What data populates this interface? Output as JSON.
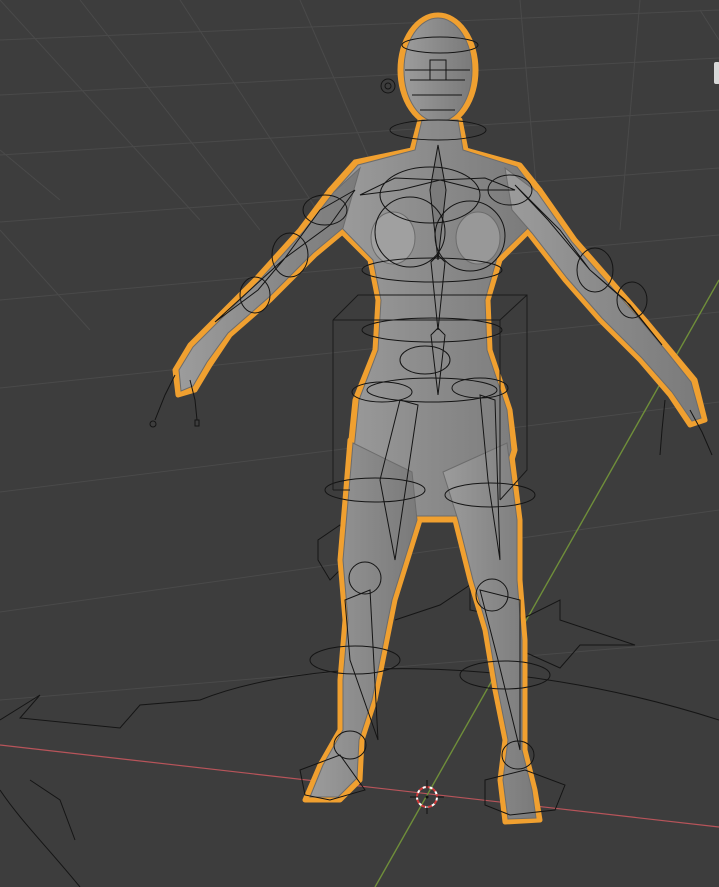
{
  "viewport": {
    "background": "#3d3d3d",
    "grid_color": "#4a4a4a",
    "x_axis_color": "#b8545a",
    "y_axis_color": "#6f8e3a",
    "selection_outline_color": "#f0a030",
    "mesh_color": "#8f8f8f",
    "armature_wire_color": "#111111",
    "scene_objects": [
      "character-mesh",
      "armature-rig",
      "bounding-box",
      "3d-cursor"
    ]
  }
}
